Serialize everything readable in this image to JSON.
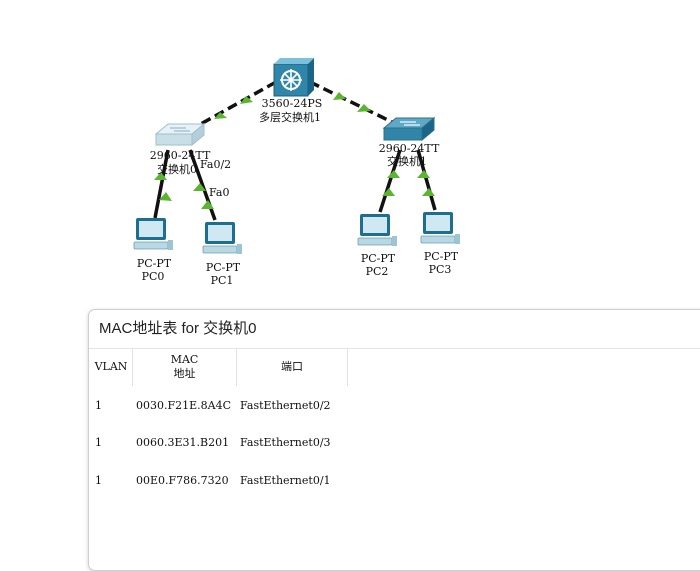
{
  "topology": {
    "devices": [
      {
        "id": "ml-switch",
        "model": "3560-24PS",
        "name": "多层交换机1"
      },
      {
        "id": "switch0",
        "model": "2960-24TT",
        "name": "交换机0"
      },
      {
        "id": "switch1",
        "model": "2960-24TT",
        "name": "交换机1"
      },
      {
        "id": "pc0",
        "model": "PC-PT",
        "name": "PC0"
      },
      {
        "id": "pc1",
        "model": "PC-PT",
        "name": "PC1"
      },
      {
        "id": "pc2",
        "model": "PC-PT",
        "name": "PC2"
      },
      {
        "id": "pc3",
        "model": "PC-PT",
        "name": "PC3"
      }
    ],
    "port_labels": {
      "switch0_to_pc1": "Fa0/2",
      "pc1_port": "Fa0"
    },
    "link_color": "#5cb531"
  },
  "mac_table_window": {
    "title": "MAC地址表 for 交换机0",
    "headers": {
      "vlan": "VLAN",
      "mac_line1": "MAC",
      "mac_line2": "地址",
      "port": "端口"
    },
    "rows": [
      {
        "vlan": "1",
        "mac": "0030.F21E.8A4C",
        "port": "FastEthernet0/2"
      },
      {
        "vlan": "1",
        "mac": "0060.3E31.B201",
        "port": "FastEthernet0/3"
      },
      {
        "vlan": "1",
        "mac": "00E0.F786.7320",
        "port": "FastEthernet0/1"
      }
    ]
  }
}
